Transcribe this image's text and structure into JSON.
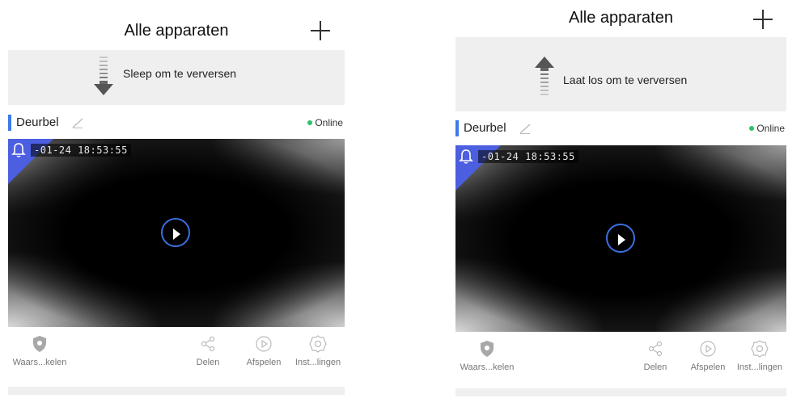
{
  "left": {
    "header": {
      "title": "Alle apparaten"
    },
    "refresh": {
      "text": "Sleep om te verversen"
    },
    "device": {
      "name": "Deurbel",
      "status": "Online",
      "timestamp": "-01-24  18:53:55"
    },
    "actions": [
      {
        "label": "Waars...kelen"
      },
      {
        "label": "Delen"
      },
      {
        "label": "Afspelen"
      },
      {
        "label": "Inst...lingen"
      }
    ]
  },
  "right": {
    "header": {
      "title": "Alle apparaten"
    },
    "refresh": {
      "text": "Laat los om te verversen"
    },
    "device": {
      "name": "Deurbel",
      "status": "Online",
      "timestamp": "-01-24  18:53:55"
    },
    "actions": [
      {
        "label": "Waars...kelen"
      },
      {
        "label": "Delen"
      },
      {
        "label": "Afspelen"
      },
      {
        "label": "Inst...lingen"
      }
    ]
  },
  "colors": {
    "accent_blue": "#3b7be8",
    "alarm_corner": "#4b5fe0",
    "online_green": "#2bc26b",
    "refresh_bg": "#efefef"
  }
}
